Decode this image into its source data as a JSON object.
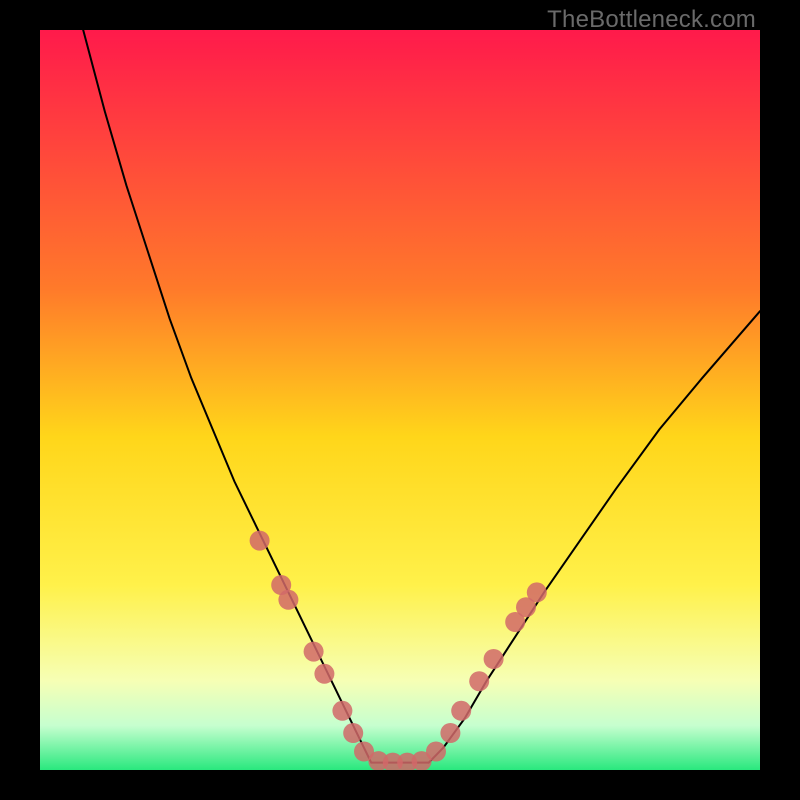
{
  "watermark": "TheBottleneck.com",
  "chart_data": {
    "type": "line",
    "title": "",
    "xlabel": "",
    "ylabel": "",
    "xlim": [
      0,
      100
    ],
    "ylim": [
      0,
      100
    ],
    "grid": false,
    "background_gradient": [
      {
        "stop": 0.0,
        "color": "#ff1a4b"
      },
      {
        "stop": 0.35,
        "color": "#ff7a2a"
      },
      {
        "stop": 0.55,
        "color": "#ffd61a"
      },
      {
        "stop": 0.75,
        "color": "#fff14a"
      },
      {
        "stop": 0.88,
        "color": "#f6ffb5"
      },
      {
        "stop": 0.94,
        "color": "#c6ffcf"
      },
      {
        "stop": 1.0,
        "color": "#29e87e"
      }
    ],
    "series": [
      {
        "name": "left-curve",
        "stroke": "#000000",
        "stroke_width": 2,
        "x": [
          6,
          9,
          12,
          15,
          18,
          21,
          24,
          27,
          30,
          33,
          36,
          39,
          41,
          43,
          45,
          46
        ],
        "y": [
          100,
          89,
          79,
          70,
          61,
          53,
          46,
          39,
          33,
          27,
          21,
          15,
          11,
          7,
          3,
          1
        ]
      },
      {
        "name": "bottom-flat",
        "stroke": "#000000",
        "stroke_width": 2,
        "x": [
          46,
          54
        ],
        "y": [
          1,
          1
        ]
      },
      {
        "name": "right-curve",
        "stroke": "#000000",
        "stroke_width": 2,
        "x": [
          54,
          56,
          59,
          62,
          66,
          70,
          75,
          80,
          86,
          92,
          100
        ],
        "y": [
          1,
          3,
          7,
          12,
          18,
          24,
          31,
          38,
          46,
          53,
          62
        ]
      }
    ],
    "markers": {
      "name": "highlight-dots",
      "color": "#d16868",
      "radius": 10,
      "points": [
        {
          "x": 30.5,
          "y": 31
        },
        {
          "x": 33.5,
          "y": 25
        },
        {
          "x": 34.5,
          "y": 23
        },
        {
          "x": 38.0,
          "y": 16
        },
        {
          "x": 39.5,
          "y": 13
        },
        {
          "x": 42.0,
          "y": 8
        },
        {
          "x": 43.5,
          "y": 5
        },
        {
          "x": 45.0,
          "y": 2.5
        },
        {
          "x": 47.0,
          "y": 1.2
        },
        {
          "x": 49.0,
          "y": 1.0
        },
        {
          "x": 51.0,
          "y": 1.0
        },
        {
          "x": 53.0,
          "y": 1.2
        },
        {
          "x": 55.0,
          "y": 2.5
        },
        {
          "x": 57.0,
          "y": 5
        },
        {
          "x": 58.5,
          "y": 8
        },
        {
          "x": 61.0,
          "y": 12
        },
        {
          "x": 63.0,
          "y": 15
        },
        {
          "x": 66.0,
          "y": 20
        },
        {
          "x": 67.5,
          "y": 22
        },
        {
          "x": 69.0,
          "y": 24
        }
      ]
    }
  }
}
